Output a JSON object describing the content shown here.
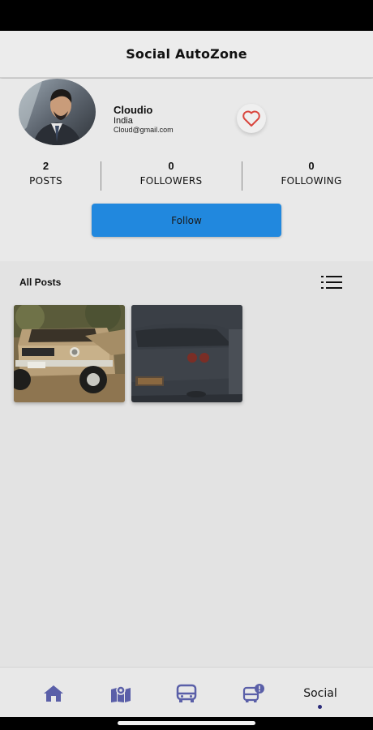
{
  "header": {
    "title": "Social AutoZone"
  },
  "profile": {
    "name": "Cloudio",
    "country": "India",
    "email": "Cloud@gmail.com",
    "avatar_icon": "profile-photo",
    "like_icon": "heart-outline-icon",
    "like_color": "#d9453d"
  },
  "stats": [
    {
      "value": "2",
      "label": "POSTS"
    },
    {
      "value": "0",
      "label": "FOLLOWERS"
    },
    {
      "value": "0",
      "label": "FOLLOWING"
    }
  ],
  "follow_button": {
    "label": "Follow",
    "color": "#2188de"
  },
  "posts": {
    "title": "All Posts",
    "list_icon": "list-view-icon",
    "items": [
      {
        "subject": "vintage-pickup-truck-photo"
      },
      {
        "subject": "sports-car-rear-photo"
      }
    ]
  },
  "bottom_nav": {
    "icon_color": "#5a5fa8",
    "items": [
      {
        "icon": "home-icon"
      },
      {
        "icon": "map-icon"
      },
      {
        "icon": "bus-icon"
      },
      {
        "icon": "bus-alert-icon"
      },
      {
        "label": "Social",
        "active": true
      }
    ]
  }
}
